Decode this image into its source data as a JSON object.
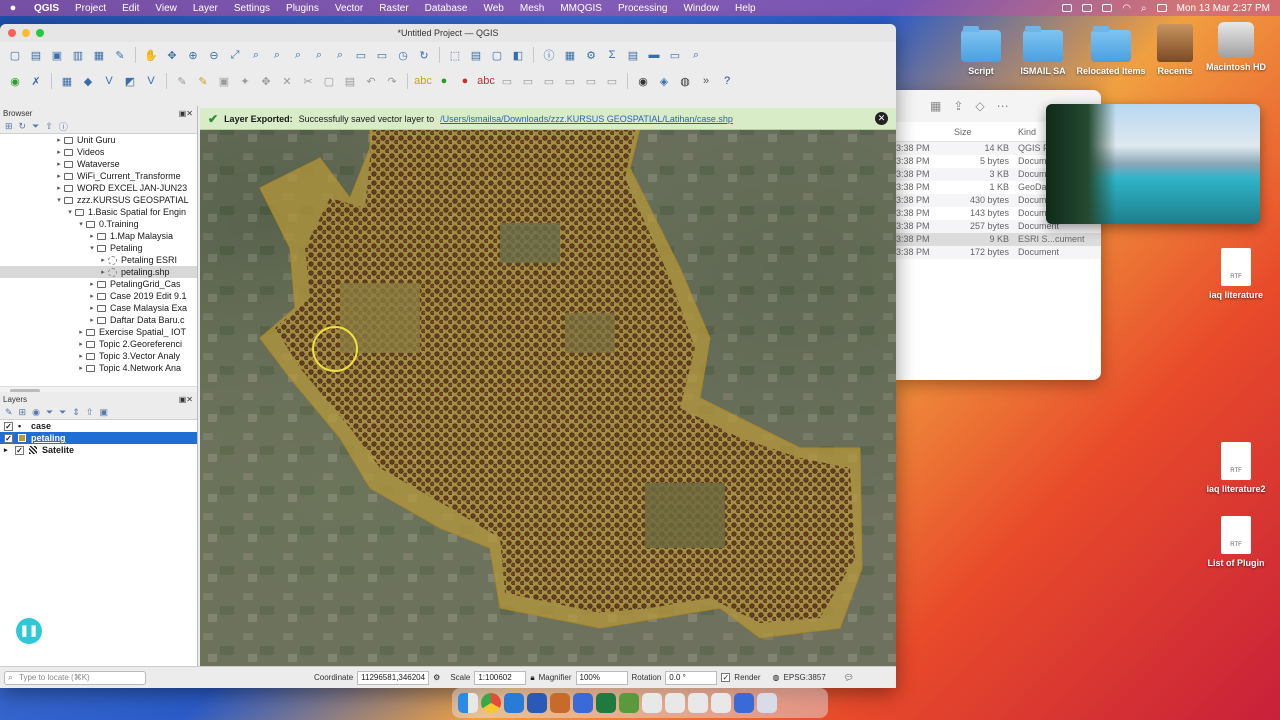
{
  "menubar": {
    "app": "QGIS",
    "items": [
      "Project",
      "Edit",
      "View",
      "Layer",
      "Settings",
      "Plugins",
      "Vector",
      "Raster",
      "Database",
      "Web",
      "Mesh",
      "MMQGIS",
      "Processing",
      "Window",
      "Help"
    ],
    "clock": "Mon 13 Mar  2:37 PM"
  },
  "desktop": {
    "icons": [
      "Script",
      "ISMAIL SA",
      "Relocated Items",
      "Recents",
      "Macintosh HD"
    ],
    "files": [
      "iaq literature",
      "iaq literature2",
      "List of Plugin"
    ],
    "rtf_label": "RTF"
  },
  "finder": {
    "col_size": "Size",
    "col_kind": "Kind",
    "rows": [
      {
        "time": "3:38 PM",
        "size": "14 KB",
        "kind": "QGIS P"
      },
      {
        "time": "3:38 PM",
        "size": "5 bytes",
        "kind": "Docum"
      },
      {
        "time": "3:38 PM",
        "size": "3 KB",
        "kind": "Docum"
      },
      {
        "time": "3:38 PM",
        "size": "1 KB",
        "kind": "GeoDa"
      },
      {
        "time": "3:38 PM",
        "size": "430 bytes",
        "kind": "Docum"
      },
      {
        "time": "3:38 PM",
        "size": "143 bytes",
        "kind": "Docum"
      },
      {
        "time": "3:38 PM",
        "size": "257 bytes",
        "kind": "Document"
      },
      {
        "time": "3:38 PM",
        "size": "9 KB",
        "kind": "ESRI S...cument"
      },
      {
        "time": "3:38 PM",
        "size": "172 bytes",
        "kind": "Document"
      }
    ]
  },
  "qgis": {
    "title": "*Untitled Project — QGIS",
    "browser_title": "Browser",
    "layers_title": "Layers",
    "browser_items": [
      {
        "label": "Unit Guru",
        "indent": 0
      },
      {
        "label": "Videos",
        "indent": 0
      },
      {
        "label": "Wataverse",
        "indent": 0
      },
      {
        "label": "WiFi_Current_Transforme",
        "indent": 0
      },
      {
        "label": "WORD EXCEL JAN-JUN23",
        "indent": 0
      },
      {
        "label": "zzz.KURSUS GEOSPATIAL",
        "indent": 0
      },
      {
        "label": "1.Basic Spatial for Engin",
        "indent": 1
      },
      {
        "label": "0.Training",
        "indent": 2
      },
      {
        "label": "1.Map Malaysia",
        "indent": 3
      },
      {
        "label": "Petaling",
        "indent": 3
      },
      {
        "label": "Petaling ESRI",
        "indent": 4
      },
      {
        "label": "petaling.shp",
        "indent": 4
      },
      {
        "label": "PetalingGrid_Cas",
        "indent": 3
      },
      {
        "label": "Case 2019 Edit 9.1",
        "indent": 3
      },
      {
        "label": "Case Malaysia Exa",
        "indent": 3
      },
      {
        "label": "Daftar Data Baru.c",
        "indent": 3
      },
      {
        "label": "Exercise Spatial_ IOT",
        "indent": 2
      },
      {
        "label": "Topic 2.Georeferenci",
        "indent": 2
      },
      {
        "label": "Topic 3.Vector Analy",
        "indent": 2
      },
      {
        "label": "Topic 4.Network Ana",
        "indent": 2
      }
    ],
    "layers": [
      {
        "name": "case",
        "checked": true
      },
      {
        "name": "petaling",
        "checked": true
      },
      {
        "name": "Satelite",
        "checked": true
      }
    ],
    "message": {
      "bold": "Layer Exported:",
      "text": "Successfully saved vector layer to",
      "link": "/Users/ismailsa/Downloads/zzz.KURSUS GEOSPATIAL/Latihan/case.shp"
    },
    "status": {
      "locate_placeholder": "Type to locate (⌘K)",
      "coordinate_label": "Coordinate",
      "coordinate": "11296581,346204",
      "scale_label": "Scale",
      "scale": "1:100602",
      "magnifier_label": "Magnifier",
      "magnifier": "100%",
      "rotation_label": "Rotation",
      "rotation": "0.0 °",
      "render_label": "Render",
      "crs": "EPSG:3857"
    }
  },
  "colors": {
    "polygon_fill": "#b89a3a",
    "points": "#5a2e1a",
    "selection": "#1f6ed4"
  }
}
